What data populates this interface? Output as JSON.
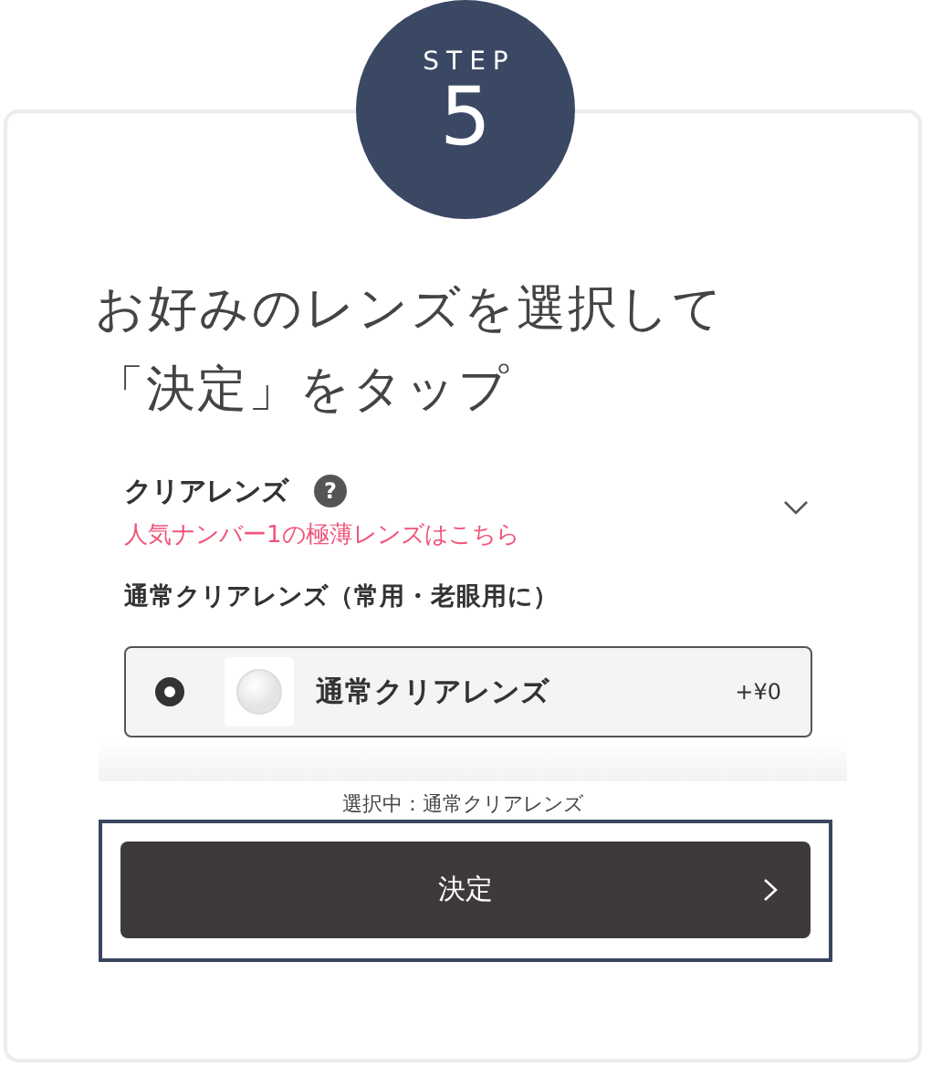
{
  "step": {
    "label": "STEP",
    "number": "5"
  },
  "title": "お好みのレンズを選択して「決定」をタップ",
  "section": {
    "title": "クリアレンズ",
    "help": "?",
    "promo": "人気ナンバー1の極薄レンズはこちら",
    "subheading": "通常クリアレンズ（常用・老眼用に）",
    "options": [
      {
        "name": "通常クリアレンズ",
        "price": "+¥0",
        "selected": true
      }
    ]
  },
  "selection_note": "選択中：通常クリアレンズ",
  "confirm_button": {
    "label": "決定",
    "focused": true
  }
}
